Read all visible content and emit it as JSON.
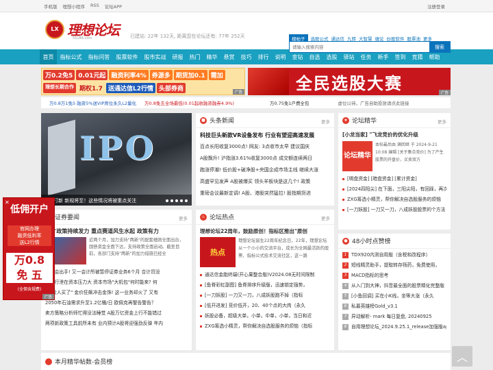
{
  "topbar": {
    "links": [
      "手机版",
      "理想小程序",
      "RSS",
      "论坛APP"
    ],
    "right": "注册登录"
  },
  "header": {
    "logo_badge": "LX",
    "logo_text": "理想论坛",
    "logo_domain": "55188.com",
    "stats": "已建站: 22年 132天, 距离您在论坛还有: 77年 252天",
    "search_tabs": [
      "搜帖子",
      "选股公式",
      "通达信",
      "九转",
      "大智慧",
      "缠论",
      "炒股软件",
      "股票池",
      "更多"
    ],
    "search_placeholder": "请输入搜索内容",
    "search_button": "搜索"
  },
  "nav": [
    "首页",
    "指标公式",
    "指标问答",
    "股票软件",
    "股市实战",
    "研报",
    "热门",
    "精华",
    "悬赏",
    "技巧",
    "排行",
    "说明",
    "金钻",
    "自选",
    "选股",
    "驿站",
    "任务",
    "新手",
    "签到",
    "竞猜",
    "帮助"
  ],
  "ad_left": {
    "row1": [
      "万0.2免5",
      "0.01元起",
      "融资利率4%",
      "券源多",
      "期货加0.1",
      "需加"
    ],
    "row2": [
      "理想长期合作",
      "期权1.7",
      "送通达信L2行情",
      "头部券商"
    ],
    "tag": "广告"
  },
  "ad_right": {
    "text": "全民选股大赛",
    "tag": "广告"
  },
  "ticker": [
    {
      "text": "万0.8万1免5 融资5%送VIP席位永久L2量化",
      "cls": "c"
    },
    {
      "text": "万0.8免五全场最低(0.01起收融资融券4.9%)",
      "cls": "k"
    },
    {
      "text": "万0.75免1户费全包",
      "cls": "g"
    },
    {
      "text": "虚位以待，广告自助投放请点此链接",
      "cls": "m"
    }
  ],
  "slider": {
    "overlay": "IPO",
    "caption": "国平打新 新规将至！这些情况将被重点关注"
  },
  "headline_news": {
    "title": "头条新闻",
    "more": "更多",
    "items": [
      "科技巨头新款VR设备发布 行业有望迎高速发展",
      "百点长阳收复3000点! 网友: 3点收市太早 建议国庆",
      "A股飘升! 沪指涨3.61%收复3000点 成交额连续两日",
      "跑涨停潮! 低价股+破净股+央国企成市场主线 继续大涨",
      "高盛罕见发声 A股被爆买 领头羊板块是这几个! 政策",
      "重磅会议最新定调! A股、港股突然猛拉! 股指期货进"
    ]
  },
  "jinghua": {
    "title": "论坛精华",
    "more": "更多",
    "feature_title": "[小龙当家] \"飞龙竞价的优化升级",
    "feature_logo": "论坛精华",
    "feature_meta": "本帖最后由 满回继 于 2024-9-21 10:08 编辑 [关于集合竞价] 为了产生股票的开盘价，买卖双方",
    "items": [
      "[明盘资金] [暗盘资金] [累计资金]",
      "[2024四阳尖] 在下面，三阳尖阳，有回踩，再次突破",
      "ZXG筹选小精灵，帮你解决自选股服务的烦恼",
      "[一刀妖股] 一刀又一刀，八成妖股股票的个方法"
    ]
  },
  "securities": {
    "title": "证券要闻",
    "more": "更多",
    "feature_title": "\"新\"政策持续发力 重点赛道风生水起 政策有力",
    "feature_body": "近两个月，加力支持\"两新\"的配套细则全面出台，国债资金全面下达，支持政策全面启动。截至目前，各部门支持\"两新\"的加力措施已经全",
    "items": [
      "正监会出手! 又一会计所被暂停证券业务6个月 合计罚没",
      "小较行泄在资本压力大 资本市场\"大机包\"何时能来? 何",
      "\"都没人买了\" 金价狂飙冲击金饰! 这一业务却火了 又有",
      "2050年石油需求升至1.2亿桶/日 欧佩克再警告警告？",
      "卖方策略分析师忙得没法睡觉 A股万亿资金上行不能错过",
      "两项新政策工具前所未有 业内预计A股将迎强劲反弹 年内"
    ]
  },
  "hot": {
    "title": "论坛热点",
    "more": "更多",
    "feature_title": "理想论坛22周年，鼓励原创！指标区推出\"原创",
    "feature_badge": "热点",
    "feature_body": "理想论坛诞生22周年纪念日，22年，理想论坛从一个小小的交流平台，成长为全网最活跃的股票、指标公式技术交流社区，这一路",
    "items": [
      "通达信金脂终端(开心果整合版)V2024.08无时间限制",
      "[鱼脊彩虹副图] 鱼脊排序升级版，迅速锁定强势，",
      "[一刀妖股] 一刀又一刀，八成妖股跑不掉（指标",
      "[低开进发] 竞价低开，20、40个点的大肉（永久",
      "妖股必备，超级大单，小单，中单，小单，当日和近",
      "ZXG筹选小精灵，帮你解决自选股服务的烦恼（指标"
    ]
  },
  "hot48": {
    "title": "48小时点赞榜",
    "items": [
      "TDX920内测自用版（含税和改程序）",
      "短线精灵助手，提取转存筛药，免费使用，",
      "MACD指标的思考",
      "从入门到大神，抖音最全面的股票精化完整版",
      "[小鱼回调] 买在小K线，坐等大涨（永久",
      "私募英雄榜Gold_v3.1",
      "异动解析- mark 每日复盘, 20240925",
      "自用理想论坛_2024.9.25.1_release加强版apk"
    ]
  },
  "float_ad": {
    "close": "✕",
    "t1": "低佣开户",
    "t2": "官网办理\n融资低利率\n送L2行情",
    "t3": "万0.8\n免 五",
    "t4": "(全佣含规费)",
    "tag": "广告"
  },
  "bottom": {
    "title": "本月精华帖数-会员榜"
  }
}
